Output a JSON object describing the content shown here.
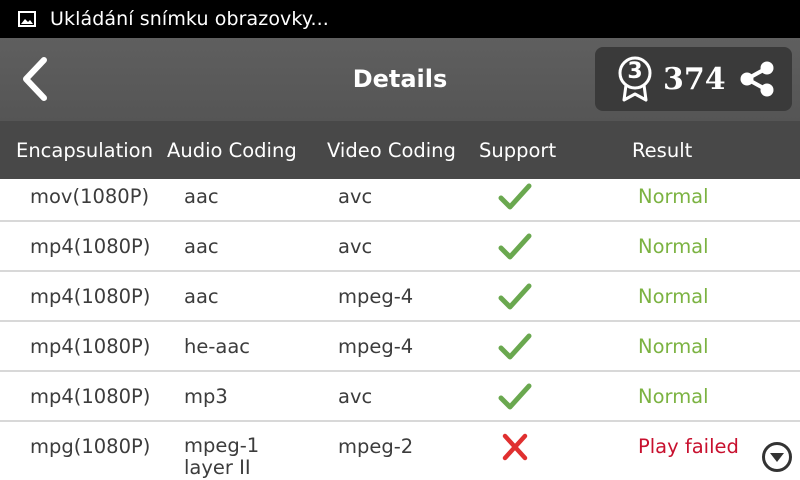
{
  "status_bar": {
    "icon": "image-icon",
    "text": "Ukládání snímku obrazovky..."
  },
  "header": {
    "title": "Details",
    "back_icon": "chevron-left-icon",
    "rank": "3",
    "score": "374",
    "share_icon": "share-icon"
  },
  "table": {
    "columns": [
      "Encapsulation",
      "Audio Coding",
      "Video Coding",
      "Support",
      "Result"
    ],
    "rows": [
      {
        "encapsulation": "mov(1080P)",
        "audio": "aac",
        "video": "avc",
        "support": true,
        "result": "Normal"
      },
      {
        "encapsulation": "mp4(1080P)",
        "audio": "aac",
        "video": "avc",
        "support": true,
        "result": "Normal"
      },
      {
        "encapsulation": "mp4(1080P)",
        "audio": "aac",
        "video": "mpeg-4",
        "support": true,
        "result": "Normal"
      },
      {
        "encapsulation": "mp4(1080P)",
        "audio": "he-aac",
        "video": "mpeg-4",
        "support": true,
        "result": "Normal"
      },
      {
        "encapsulation": "mp4(1080P)",
        "audio": "mp3",
        "video": "avc",
        "support": true,
        "result": "Normal"
      },
      {
        "encapsulation": "mpg(1080P)",
        "audio": "mpeg-1 layer II",
        "video": "mpeg-2",
        "support": false,
        "result": "Play failed"
      }
    ]
  },
  "colors": {
    "ok": "#7cb342",
    "fail": "#c8102e",
    "check": "#6aa84f",
    "cross": "#e03030"
  },
  "scroll_icon": "chevron-down-circle-icon"
}
